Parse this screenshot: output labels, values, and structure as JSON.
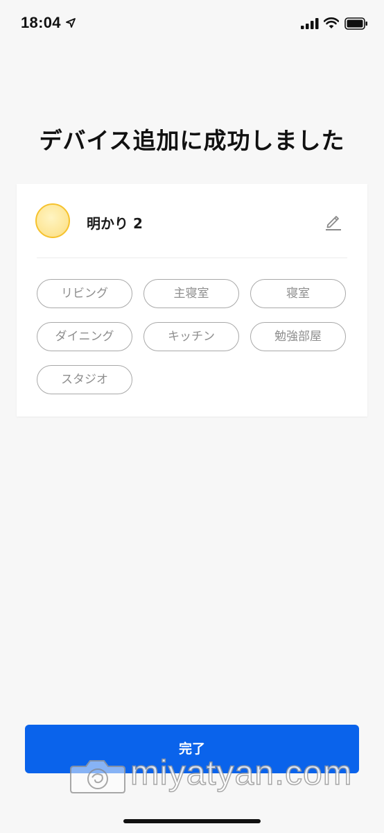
{
  "status_bar": {
    "time": "18:04"
  },
  "title": "デバイス追加に成功しました",
  "device": {
    "name": "明かり 2"
  },
  "rooms": [
    "リビング",
    "主寝室",
    "寝室",
    "ダイニング",
    "キッチン",
    "勉強部屋",
    "スタジオ"
  ],
  "done_label": "完了",
  "watermark": "miyatyan.com",
  "colors": {
    "accent": "#0a63eb",
    "bulb": "#fde79a",
    "background": "#f7f7f7"
  }
}
